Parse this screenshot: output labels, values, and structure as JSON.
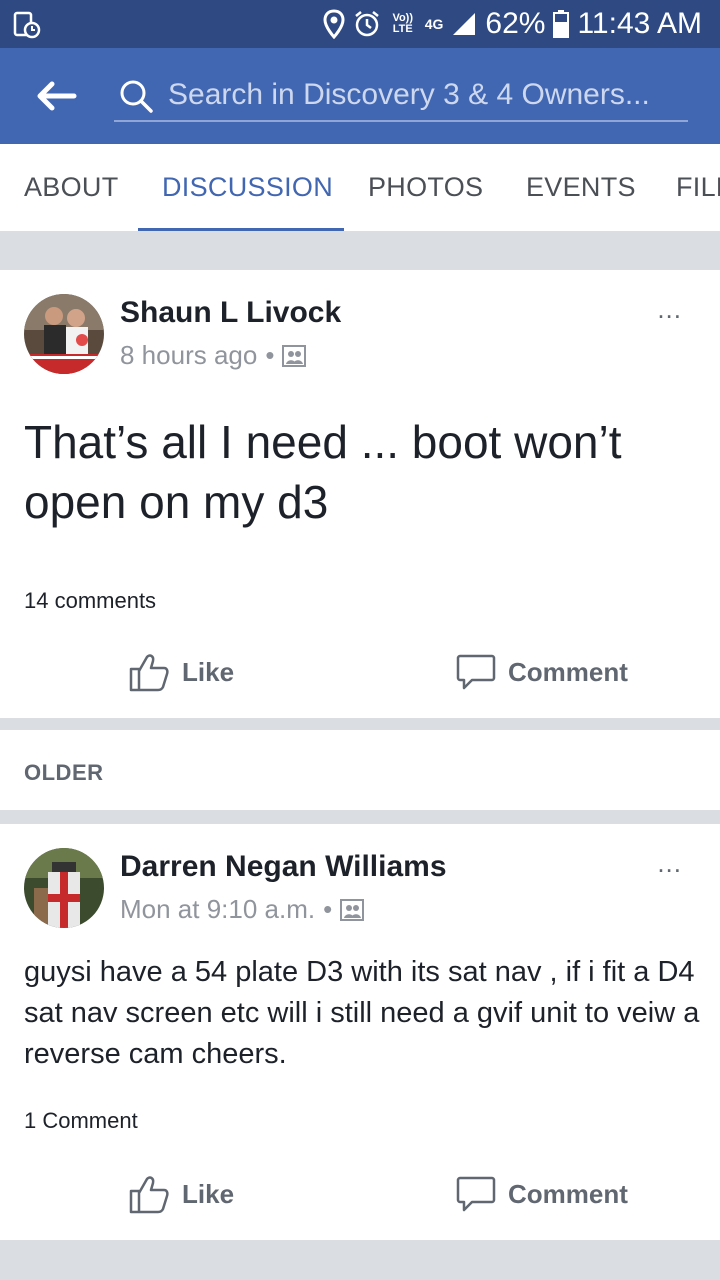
{
  "status_bar": {
    "volte": "Vo)) LTE",
    "network": "4G",
    "battery": "62%",
    "time": "11:43 AM"
  },
  "app_bar": {
    "search_placeholder": "Search in Discovery 3 & 4 Owners..."
  },
  "tabs": [
    {
      "label": "ABOUT",
      "active": false
    },
    {
      "label": "DISCUSSION",
      "active": true
    },
    {
      "label": "PHOTOS",
      "active": false
    },
    {
      "label": "EVENTS",
      "active": false
    },
    {
      "label": "FILE",
      "active": false
    }
  ],
  "posts": [
    {
      "author": "Shaun L Livock",
      "time": "8 hours ago",
      "text": "That’s all I need ... boot won’t open on my d3",
      "comments": "14 comments",
      "like_label": "Like",
      "comment_label": "Comment",
      "more": "..."
    },
    {
      "author": "Darren Negan Williams",
      "time": "Mon at 9:10 a.m.",
      "text": "guysi have a  54 plate D3 with its sat nav ,  if i fit a D4 sat nav screen etc will i still need a gvif unit to veiw a reverse cam cheers.",
      "comments": "1 Comment",
      "like_label": "Like",
      "comment_label": "Comment",
      "more": "..."
    }
  ],
  "older_label": "OLDER",
  "colors": {
    "status_bar": "#2f4a82",
    "app_bar": "#4267b2",
    "active_tab": "#4267b2",
    "divider": "#dadde1"
  }
}
